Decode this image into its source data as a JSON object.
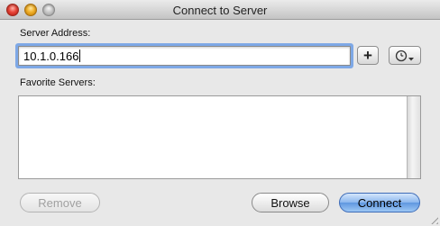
{
  "window": {
    "title": "Connect to Server"
  },
  "server_address": {
    "label": "Server Address:",
    "value": "10.1.0.166",
    "add_button_label": "+"
  },
  "favorites": {
    "label": "Favorite Servers:",
    "items": []
  },
  "buttons": {
    "remove": "Remove",
    "browse": "Browse",
    "connect": "Connect"
  },
  "icons": {
    "history": "clock-icon",
    "dropdown": "chevron-down-icon"
  },
  "colors": {
    "accent": "#7ea8e6",
    "default_button": "#5f97e0"
  }
}
